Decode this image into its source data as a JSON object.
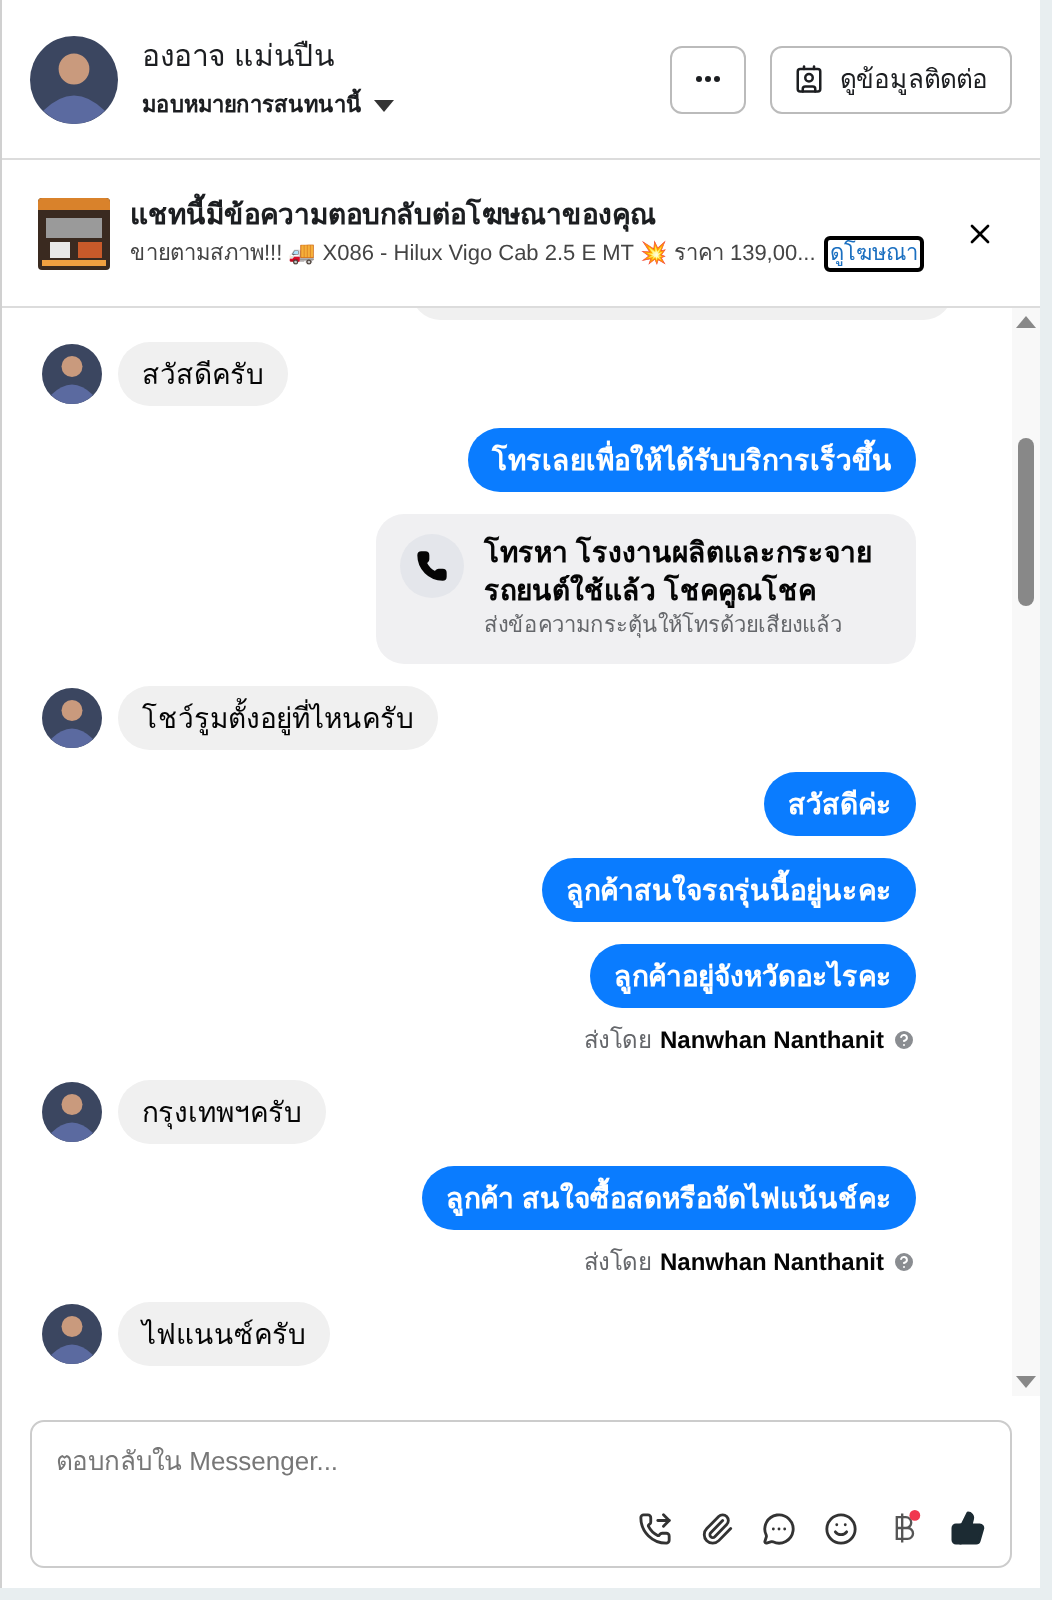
{
  "header": {
    "name": "องอาจ แม่นปืน",
    "assign_label": "มอบหมายการสนทนานี้",
    "contact_button": "ดูข้อมูลติดต่อ"
  },
  "ad_banner": {
    "title": "แชทนี้มีข้อความตอบกลับต่อโฆษณาของคุณ",
    "description": "ขายตามสภาพ!!! 🚚 X086 - Hilux Vigo Cab 2.5 E MT 💥 ราคา 139,00...",
    "link": "ดูโฆษณา"
  },
  "messages": [
    {
      "kind": "cut"
    },
    {
      "kind": "incoming",
      "text": "สวัสดีครับ"
    },
    {
      "kind": "outgoing",
      "text": "โทรเลยเพื่อให้ได้รับบริการเร็วขึ้น"
    },
    {
      "kind": "call_card",
      "title": "โทรหา โรงงานผลิตและกระจายรถยนต์ใช้แล้ว โชคคูณโชค",
      "subtitle": "ส่งข้อความกระตุ้นให้โทรด้วยเสียงแล้ว"
    },
    {
      "kind": "incoming",
      "text": "โชว์รูมตั้งอยู่ที่ไหนครับ"
    },
    {
      "kind": "outgoing",
      "text": "สวัสดีค่ะ"
    },
    {
      "kind": "outgoing",
      "text": "ลูกค้าสนใจรถรุ่นนี้อยู่นะคะ"
    },
    {
      "kind": "outgoing",
      "text": "ลูกค้าอยู่จังหวัดอะไรคะ"
    },
    {
      "kind": "sender",
      "prefix": "ส่งโดย",
      "name": "Nanwhan Nanthanit"
    },
    {
      "kind": "incoming",
      "text": "กรุงเทพฯครับ"
    },
    {
      "kind": "outgoing",
      "text": "ลูกค้า สนใจซื้อสดหรือจัดไฟแน้นช์คะ"
    },
    {
      "kind": "sender",
      "prefix": "ส่งโดย",
      "name": "Nanwhan Nanthanit"
    },
    {
      "kind": "incoming",
      "text": "ไฟแนนซ์ครับ"
    }
  ],
  "composer": {
    "placeholder": "ตอบกลับใน Messenger..."
  }
}
